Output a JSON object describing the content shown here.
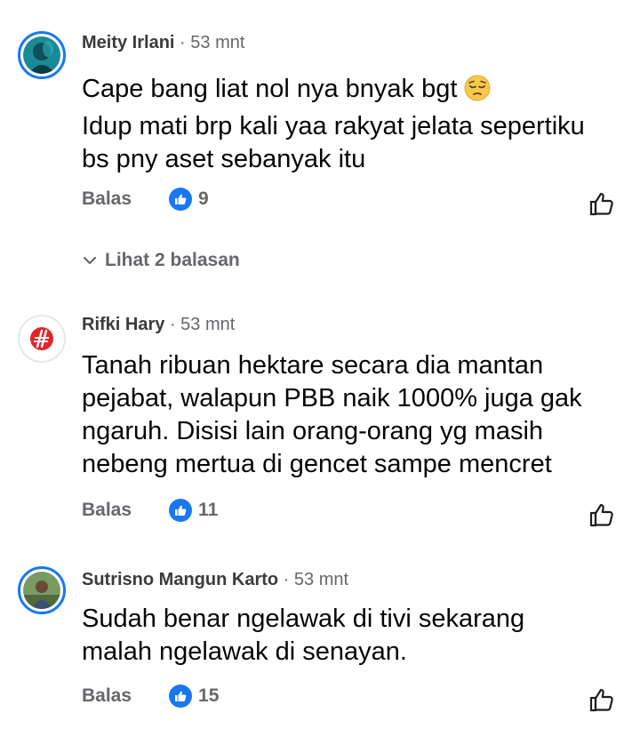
{
  "comments": [
    {
      "name": "Meity Irlani",
      "separator": "·",
      "time": "53 mnt",
      "lines": [
        "Cape bang liat nol nya bnyak bgt",
        "Idup mati brp kali yaa rakyat jelata sepertiku",
        "bs pny aset sebanyak itu"
      ],
      "emoji": "pensive-face-emoji",
      "reply_label": "Balas",
      "reaction_icon": "like-icon",
      "reaction_count": "9",
      "view_replies_label": "Lihat 2 balasan"
    },
    {
      "name": "Rifki Hary",
      "separator": "·",
      "time": "53 mnt",
      "lines": [
        "Tanah ribuan hektare secara dia mantan",
        "pejabat, walapun PBB naik 1000% juga gak",
        "ngaruh. Disisi lain orang-orang yg masih",
        "nebeng mertua di gencet sampe mencret"
      ],
      "reply_label": "Balas",
      "reaction_icon": "like-icon",
      "reaction_count": "11"
    },
    {
      "name": "Sutrisno Mangun Karto",
      "separator": "·",
      "time": "53 mnt",
      "lines": [
        "Sudah benar ngelawak di tivi sekarang",
        "malah ngelawak di senayan."
      ],
      "reply_label": "Balas",
      "reaction_icon": "like-icon",
      "reaction_count": "15"
    }
  ],
  "colors": {
    "accent": "#1877f2",
    "text_primary": "#050505",
    "text_secondary": "#65676b",
    "logo_red": "#e0262c"
  }
}
